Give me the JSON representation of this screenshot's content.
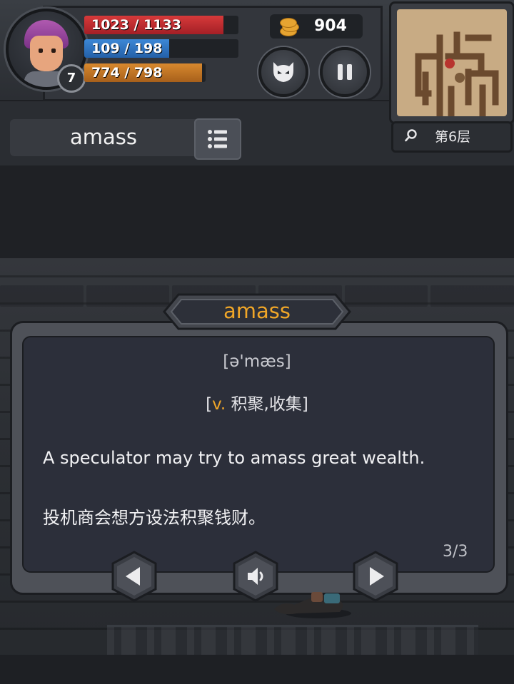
{
  "hud": {
    "level": "7",
    "hp": {
      "text": "1023 / 1133",
      "current": 1023,
      "max": 1133
    },
    "mp": {
      "text": "109 / 198",
      "current": 109,
      "max": 198
    },
    "xp": {
      "text": "774 / 798",
      "current": 774,
      "max": 798
    },
    "gold": "904"
  },
  "buttons": {
    "monster": "monster-icon",
    "pause": "pause-icon"
  },
  "minimap": {
    "floor_label": "第6层"
  },
  "current_word": "amass",
  "card": {
    "word": "amass",
    "phonetic": "[ə'mæs]",
    "pos_open": "[",
    "pos_tag": "v.",
    "pos_meaning": " 积聚,收集]",
    "example_en": "A speculator may try to amass great wealth.",
    "example_zh": "投机商会想方设法积聚钱财。",
    "page": "3/3"
  },
  "colors": {
    "accent": "#f0a628",
    "hp": "#c42d32",
    "mp": "#3274c0",
    "xp": "#c47a24",
    "panel": "#2c2f3a"
  }
}
